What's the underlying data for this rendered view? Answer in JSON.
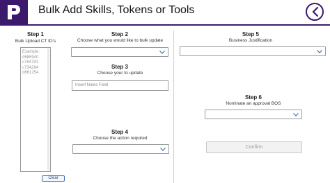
{
  "header": {
    "title": "Bulk Add Skills, Tokens or Tools",
    "logo_icon": "p-logo-icon",
    "back_icon": "chevron-left-circle-icon",
    "accent_color": "#3b1a6e"
  },
  "step1": {
    "title": "Step 1",
    "subtitle": "Bulk Upload CT ID's",
    "textarea_lines": [
      "Example:",
      "d686940",
      "c764791",
      "c734264",
      "d661254"
    ],
    "clear_label": "Clear"
  },
  "step2": {
    "title": "Step 2",
    "subtitle": "Choose what you would like to bulk update",
    "selected_value": ""
  },
  "step3": {
    "title": "Step 3",
    "subtitle": "Choose your  to update",
    "placeholder": "Insert Notes Field"
  },
  "step4": {
    "title": "Step 4",
    "subtitle": "Choose the action required",
    "selected_value": ""
  },
  "step5": {
    "title": "Step 5",
    "subtitle": "Business Justification",
    "selected_value": ""
  },
  "step6": {
    "title": "Step 6",
    "subtitle": "Nominate an approval BOS",
    "selected_value": ""
  },
  "confirm": {
    "label": "Confirm",
    "enabled": false
  }
}
